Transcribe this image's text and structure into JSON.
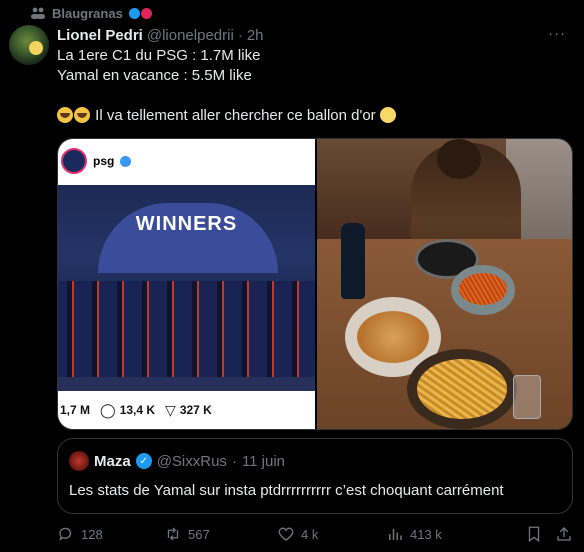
{
  "community": {
    "name": "Blaugranas",
    "icon": "community-icon",
    "badge_colors": [
      "#1d9bf0",
      "#e0245e"
    ]
  },
  "author": {
    "name": "Lionel Pedri",
    "handle": "@lionelpedrii",
    "separator": "·",
    "time": "2h"
  },
  "more_label": "···",
  "tweet": {
    "line1": "La 1ere C1 du PSG : 1.7M like",
    "line2": "Yamal en vacance : 5.5M like",
    "line4": "Il va tellement aller chercher ce ballon d'or"
  },
  "media": {
    "left": {
      "account": "psg",
      "banner": "WINNERS",
      "likes": "1,7 M",
      "comments": "13,4 K",
      "shares": "327 K"
    }
  },
  "quote": {
    "name": "Maza",
    "handle": "@SixxRus",
    "separator": "·",
    "time": "11 juin",
    "text": "Les stats de Yamal sur insta ptdrrrrrrrrrr c’est choquant carrément"
  },
  "actions": {
    "replies": "128",
    "reposts": "567",
    "likes": "4 k",
    "views": "413 k"
  },
  "colors": {
    "background": "#000000",
    "text": "#e7e9ea",
    "muted": "#71767b",
    "border": "#2f3336",
    "verified": "#1d9bf0"
  }
}
